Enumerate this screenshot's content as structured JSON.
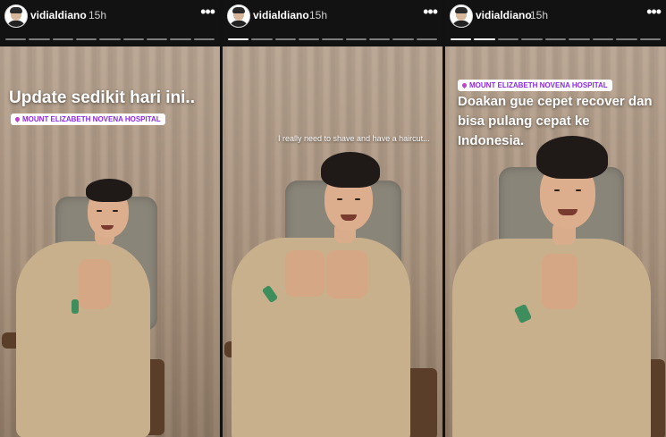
{
  "stories": [
    {
      "username": "vidialdiano",
      "time": "15h",
      "menu_icon": "more-horizontal-icon",
      "progress": {
        "segments": 9,
        "completed": 0
      },
      "caption": "Update sedikit hari ini..",
      "location": "MOUNT ELIZABETH NOVENA HOSPITAL"
    },
    {
      "username": "vidialdiano",
      "time": "15h",
      "menu_icon": "more-horizontal-icon",
      "progress": {
        "segments": 9,
        "completed": 1
      },
      "caption": "I really need to shave and have a haircut..."
    },
    {
      "username": "vidialdiano",
      "time": "15h",
      "menu_icon": "more-horizontal-icon",
      "progress": {
        "segments": 9,
        "completed": 2
      },
      "caption": "Doakan gue cepet recover dan bisa pulang cepat ke Indonesia.",
      "location": "MOUNT ELIZABETH NOVENA HOSPITAL"
    }
  ],
  "colors": {
    "topbar": "#121212",
    "curtain": "#b9a592",
    "gown": "#c9b08c",
    "wristband": "#3e8d5d",
    "location_text": "#8a2be2"
  }
}
